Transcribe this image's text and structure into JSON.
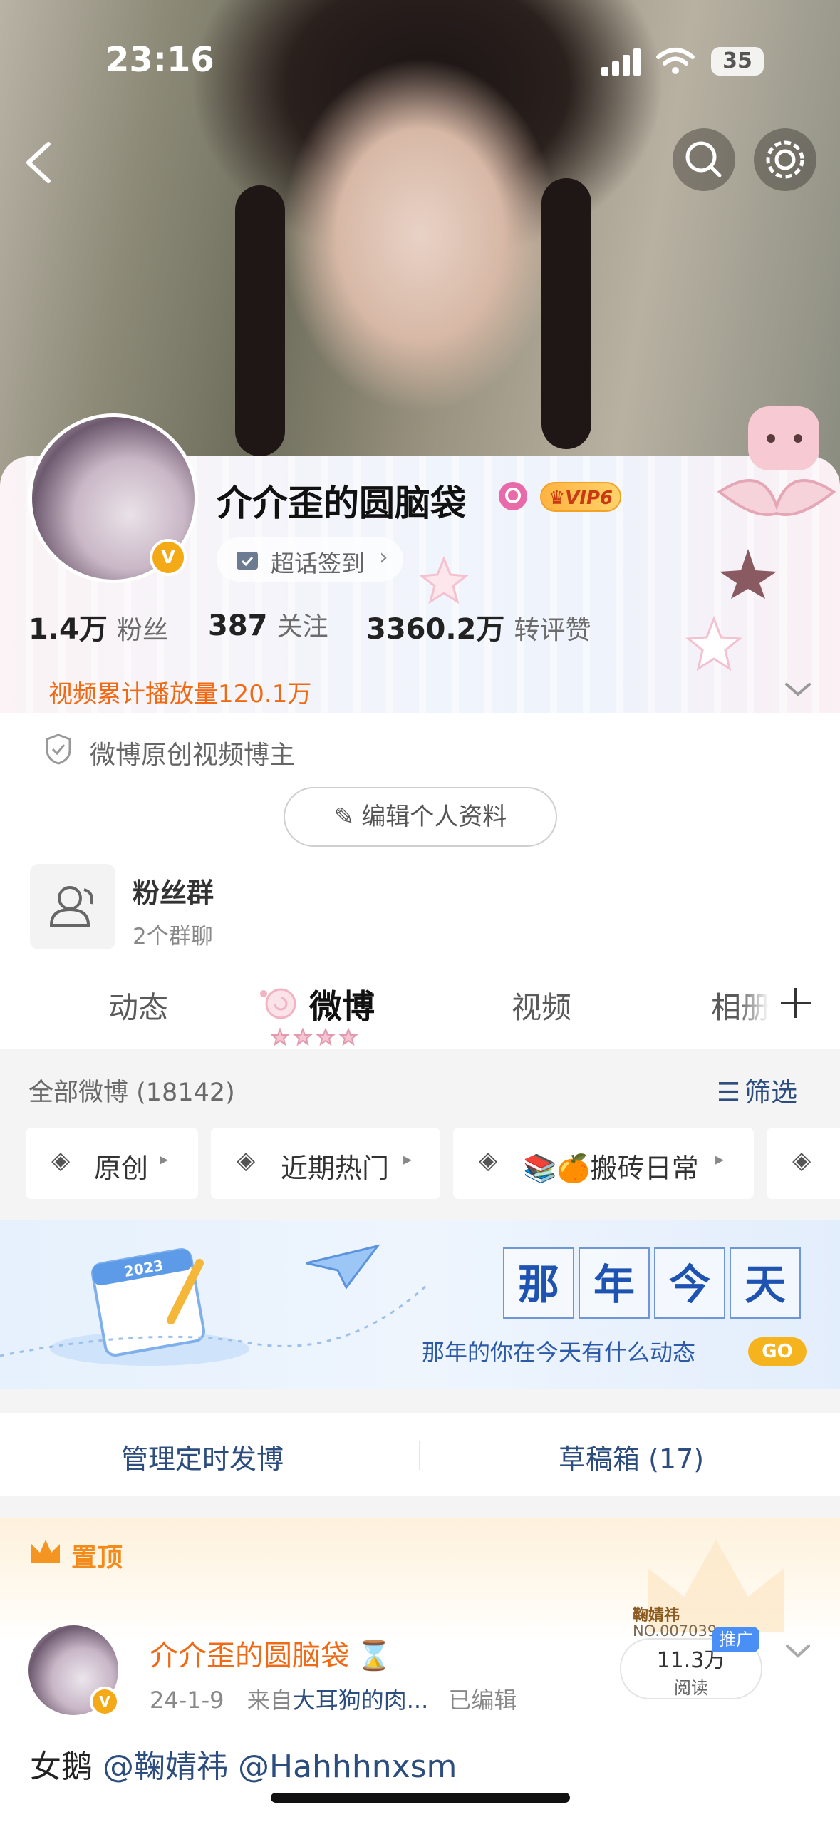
{
  "status": {
    "time": "23:16",
    "battery": "35"
  },
  "profile": {
    "name": "介介歪的圆脑袋",
    "vip": "VIP6",
    "super_checkin": "超话签到",
    "stats": [
      {
        "num": "1.4万",
        "label": "粉丝"
      },
      {
        "num": "387",
        "label": "关注"
      },
      {
        "num": "3360.2万",
        "label": "转评赞"
      }
    ],
    "video_plays": "视频累计播放量120.1万",
    "cert": "微博原创视频博主",
    "edit_label": "编辑个人资料"
  },
  "fan_group": {
    "title": "粉丝群",
    "subtitle": "2个群聊"
  },
  "tabs": [
    "动态",
    "微博",
    "视频",
    "相册"
  ],
  "feed_header": {
    "count_label": "全部微博 (18142)",
    "filter_label": "筛选"
  },
  "filters": [
    "原创",
    "近期热门",
    "📚🍊搬砖日常"
  ],
  "banner": {
    "title_chars": [
      "那",
      "年",
      "今",
      "天"
    ],
    "subtitle": "那年的你在今天有什么动态",
    "go": "GO",
    "calendar_year": "2023"
  },
  "manage": {
    "scheduled": "管理定时发博",
    "drafts": "草稿箱 (17)"
  },
  "pinned": {
    "label": "置顶",
    "author": "介介歪的圆脑袋",
    "hourglass": "⌛",
    "date": "24-1-9",
    "source_prefix": "来自",
    "source": "大耳狗的肉...",
    "edited": "已编辑",
    "reads_num": "11.3万",
    "reads_label": "阅读",
    "promo": "推广",
    "card_name": "鞠婧祎",
    "card_no": "NO.007039",
    "text_prefix": "女鹅",
    "mention1": "@鞠婧祎",
    "mention2": "@Hahhhnxsm"
  }
}
